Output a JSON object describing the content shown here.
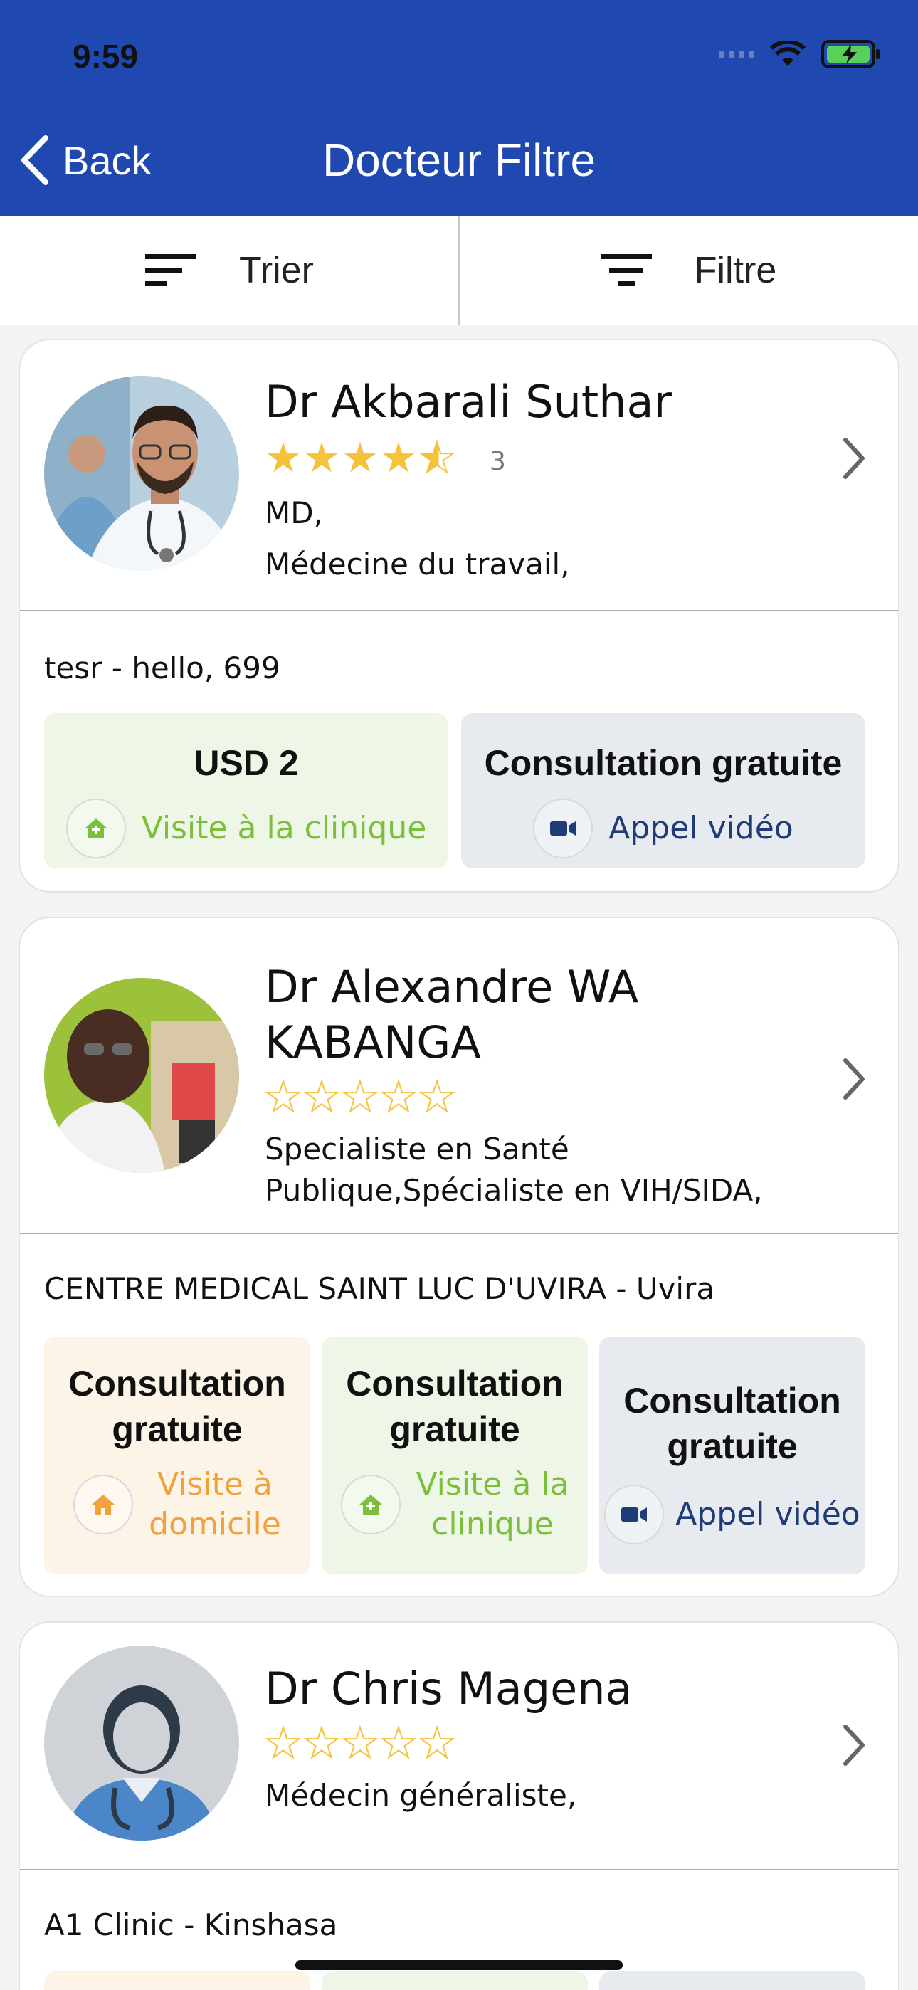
{
  "status_bar": {
    "time": "9:59"
  },
  "nav": {
    "back_label": "Back",
    "title": "Docteur Filtre"
  },
  "toolbar": {
    "sort_label": "Trier",
    "filter_label": "Filtre"
  },
  "colors": {
    "header": "#1f48b0",
    "star": "#f4c33a",
    "green_text": "#7cbf3a",
    "blue_text": "#1f3c77",
    "orange_text": "#f0a23c"
  },
  "doctors": [
    {
      "name": "Dr Akbarali Suthar",
      "rating": 4.5,
      "rating_count": "3",
      "specialty_line1": "MD,",
      "specialty_line2": "Médecine du travail,",
      "clinic": "tesr - hello, 699",
      "options": [
        {
          "price": "USD 2",
          "type": "Visite à la clinique",
          "icon": "clinic-home-icon"
        },
        {
          "price": "Consultation gratuite",
          "type": "Appel vidéo",
          "icon": "video-camera-icon"
        }
      ]
    },
    {
      "name_line1": "Dr Alexandre  WA",
      "name_line2": "KABANGA",
      "rating": 0,
      "specialty_line1": "Specialiste en Santé",
      "specialty_line2": "Publique,Spécialiste en VIH/SIDA,",
      "clinic": "CENTRE MEDICAL SAINT LUC D'UVIRA  - Uvira",
      "options": [
        {
          "price_line1": "Consultation",
          "price_line2": "gratuite",
          "type_line1": "Visite à",
          "type_line2": "domicile",
          "icon": "home-icon"
        },
        {
          "price_line1": "Consultation",
          "price_line2": "gratuite",
          "type_line1": "Visite à la",
          "type_line2": "clinique",
          "icon": "clinic-home-icon"
        },
        {
          "price_line1": "Consultation",
          "price_line2": "gratuite",
          "type": "Appel vidéo",
          "icon": "video-camera-icon"
        }
      ]
    },
    {
      "name": "Dr Chris Magena",
      "rating": 0,
      "specialty_line1": "Médecin généraliste,",
      "clinic": "A1 Clinic - Kinshasa"
    }
  ]
}
